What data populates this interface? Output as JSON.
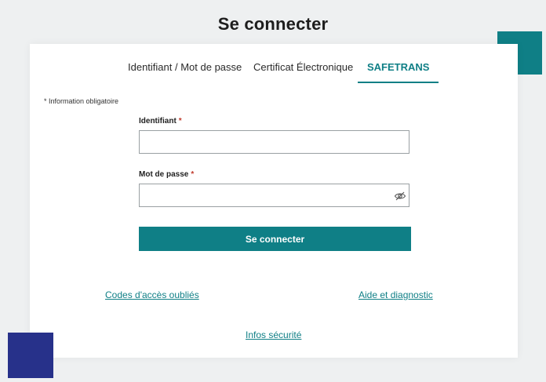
{
  "page": {
    "title": "Se connecter"
  },
  "tabs": [
    {
      "label": "Identifiant / Mot de passe",
      "active": false
    },
    {
      "label": "Certificat Électronique",
      "active": false
    },
    {
      "label": "SAFETRANS",
      "active": true
    }
  ],
  "form": {
    "required_note": "* Information obligatoire",
    "username": {
      "label": "Identifiant",
      "required_mark": "*",
      "value": "",
      "placeholder": ""
    },
    "password": {
      "label": "Mot de passe",
      "required_mark": "*",
      "value": "",
      "placeholder": ""
    },
    "submit_label": "Se connecter"
  },
  "links": {
    "forgot": "Codes d'accès oubliés",
    "help": "Aide et diagnostic",
    "security": "Infos sécurité"
  },
  "colors": {
    "accent": "#0f7f86",
    "deco_navy": "#27318a",
    "required": "#c0392b"
  },
  "icons": {
    "password_toggle": "eye-slash-icon"
  }
}
